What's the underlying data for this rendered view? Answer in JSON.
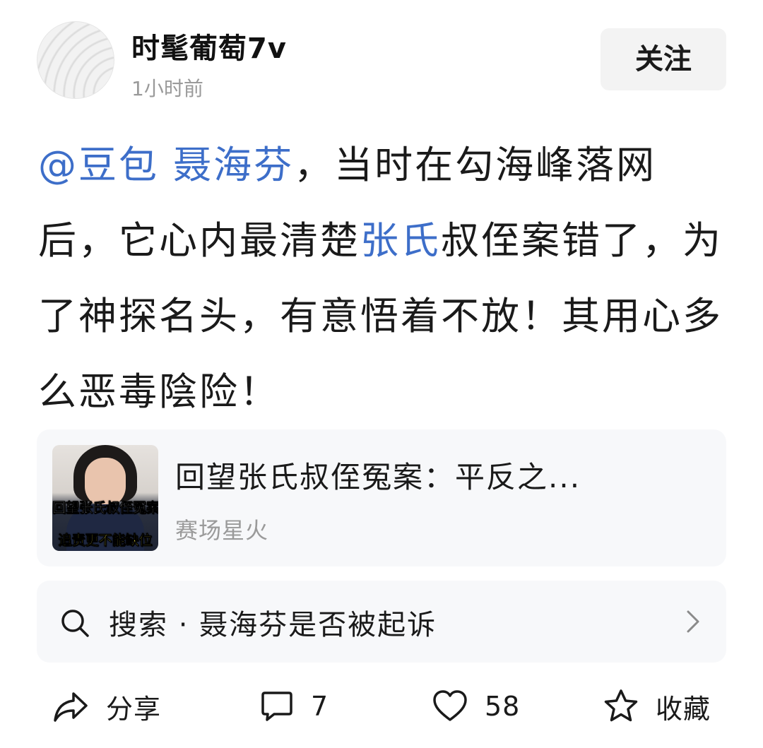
{
  "author": {
    "name": "时髦葡萄7v",
    "time": "1小时前",
    "follow_label": "关注"
  },
  "post": {
    "mention": "@豆包",
    "topic": "聂海芬",
    "text_1": "，当时在勾海峰落网后，它心内最清楚",
    "link": "张氏",
    "text_2": "叔侄案错了，为了神探名头，有意悟着不放！其用心多么恶毒陰险！"
  },
  "link_card": {
    "title": "回望张氏叔侄冤案：平反之...",
    "source": "赛场星火",
    "thumb_caption_1": "回望张氏叔侄冤案",
    "thumb_caption_2": "追责更不能缺位"
  },
  "search": {
    "text": "搜索 · 聂海芬是否被起诉"
  },
  "actions": {
    "share_label": "分享",
    "comment_count": "7",
    "like_count": "58",
    "favorite_label": "收藏"
  },
  "colors": {
    "link": "#3d6ec9",
    "card_background": "#f7f8fa",
    "follow_button": "#f3f3f3",
    "meta_text": "#9a9a9a"
  },
  "icons": [
    "share-icon",
    "comment-icon",
    "heart-icon",
    "star-icon",
    "search-icon",
    "chevron-right-icon"
  ]
}
